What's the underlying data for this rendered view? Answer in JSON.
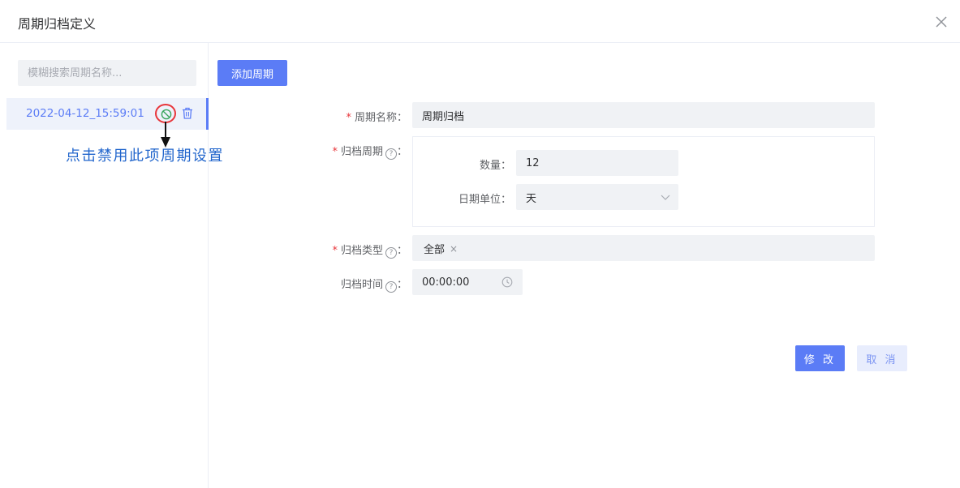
{
  "dialog": {
    "title": "周期归档定义"
  },
  "sidebar": {
    "search_placeholder": "模糊搜索周期名称...",
    "items": [
      {
        "label": "2022-04-12_15:59:01"
      }
    ],
    "annotation": "点击禁用此项周期设置"
  },
  "toolbar": {
    "add_label": "添加周期"
  },
  "form": {
    "name": {
      "label": "周期名称",
      "value": "周期归档"
    },
    "period": {
      "label": "归档周期",
      "count": {
        "label": "数量",
        "value": "12"
      },
      "unit": {
        "label": "日期单位",
        "value": "天"
      }
    },
    "type": {
      "label": "归档类型",
      "tags": [
        "全部"
      ]
    },
    "time": {
      "label": "归档时间",
      "value": "00:00:00"
    }
  },
  "actions": {
    "modify_label": "修 改",
    "cancel_label": "取 消"
  },
  "colors": {
    "primary": "#5b7cf6",
    "required": "#e8353a",
    "annotation": "#2266cc"
  },
  "icons": [
    "close-icon",
    "disable-icon",
    "trash-icon",
    "help-icon",
    "chevron-down-icon",
    "clock-icon",
    "arrow-down-icon"
  ]
}
